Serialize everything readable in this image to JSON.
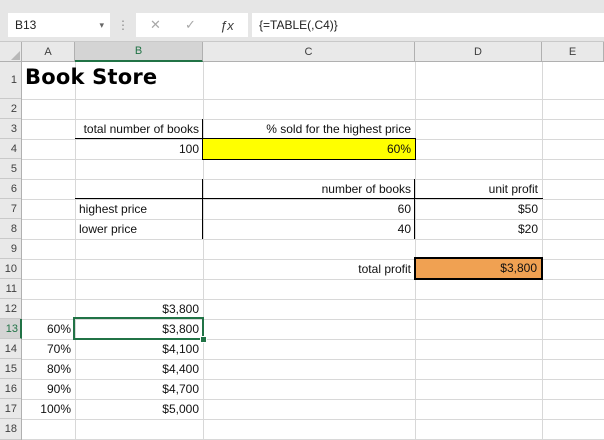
{
  "formula_bar": {
    "name_box_value": "B13",
    "formula": "{=TABLE(,C4)}"
  },
  "icons": {
    "name_box_dropdown": "▾",
    "divider_dots": "⋮",
    "cancel": "✕",
    "enter": "✓",
    "insert_function": "ƒx"
  },
  "colors": {
    "excel_green": "#217346",
    "highlight_yellow": "#FFFF00",
    "highlight_orange": "#F0A152",
    "grid_line": "#D8D8D8"
  },
  "grid": {
    "column_letters": [
      "A",
      "B",
      "C",
      "D",
      "E"
    ],
    "row_count": 18,
    "selected_row": 13,
    "selected_column": "B",
    "selected_cell": "B13"
  },
  "cells": {
    "a1_title": "Book Store",
    "b3": "total number of books",
    "c3": "% sold for the highest price",
    "b4": "100",
    "c4": "60%",
    "c6": "number of books",
    "d6": "unit profit",
    "b7": "highest price",
    "c7": "60",
    "d7": "$50",
    "b8": "lower price",
    "c8": "40",
    "d8": "$20",
    "c10": "total profit",
    "d10": "$3,800",
    "b12": "$3,800"
  },
  "data_table": {
    "percentages": [
      "60%",
      "70%",
      "80%",
      "90%",
      "100%"
    ],
    "profits": [
      "$3,800",
      "$4,100",
      "$4,400",
      "$4,700",
      "$5,000"
    ]
  }
}
